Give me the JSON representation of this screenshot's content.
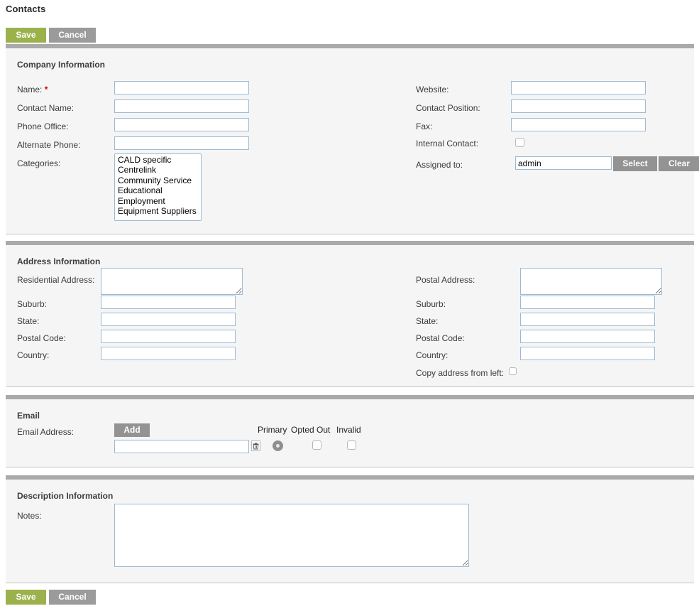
{
  "page": {
    "title": "Contacts"
  },
  "toolbar": {
    "save_label": "Save",
    "cancel_label": "Cancel"
  },
  "sections": {
    "company": {
      "title": "Company Information",
      "left": {
        "name_label": "Name:",
        "name_required_marker": "*",
        "name_value": "",
        "contact_name_label": "Contact Name:",
        "contact_name_value": "",
        "phone_office_label": "Phone Office:",
        "phone_office_value": "",
        "alternate_phone_label": "Alternate Phone:",
        "alternate_phone_value": "",
        "categories_label": "Categories:",
        "categories_options": [
          "CALD specific",
          "Centrelink",
          "Community Service",
          "Educational",
          "Employment",
          "Equipment Suppliers"
        ]
      },
      "right": {
        "website_label": "Website:",
        "website_value": "",
        "contact_position_label": "Contact Position:",
        "contact_position_value": "",
        "fax_label": "Fax:",
        "fax_value": "",
        "internal_contact_label": "Internal Contact:",
        "internal_contact_checked": false,
        "assigned_to_label": "Assigned to:",
        "assigned_to_value": "admin",
        "select_label": "Select",
        "clear_label": "Clear"
      }
    },
    "address": {
      "title": "Address Information",
      "left": {
        "residential_address_label": "Residential Address:",
        "residential_address_value": "",
        "suburb_label": "Suburb:",
        "suburb_value": "",
        "state_label": "State:",
        "state_value": "",
        "postal_code_label": "Postal Code:",
        "postal_code_value": "",
        "country_label": "Country:",
        "country_value": ""
      },
      "right": {
        "postal_address_label": "Postal Address:",
        "postal_address_value": "",
        "suburb_label": "Suburb:",
        "suburb_value": "",
        "state_label": "State:",
        "state_value": "",
        "postal_code_label": "Postal Code:",
        "postal_code_value": "",
        "country_label": "Country:",
        "country_value": "",
        "copy_address_label": "Copy address from left:",
        "copy_address_checked": false
      }
    },
    "email": {
      "title": "Email",
      "email_address_label": "Email Address:",
      "add_label": "Add",
      "col_primary": "Primary",
      "col_opted_out": "Opted Out",
      "col_invalid": "Invalid",
      "row": {
        "email_value": "",
        "delete_icon": "trash-icon",
        "primary_selected": true,
        "opted_out_checked": false,
        "invalid_checked": false
      }
    },
    "description": {
      "title": "Description Information",
      "notes_label": "Notes:",
      "notes_value": ""
    }
  },
  "colors": {
    "save_button": "#9bb24c",
    "cancel_button": "#9b9b9b",
    "gray_button": "#939393",
    "panel_bg": "#f5f5f5",
    "panel_band": "#aaaaaa",
    "input_border": "#9dbad4",
    "required_marker": "#cc0000"
  }
}
